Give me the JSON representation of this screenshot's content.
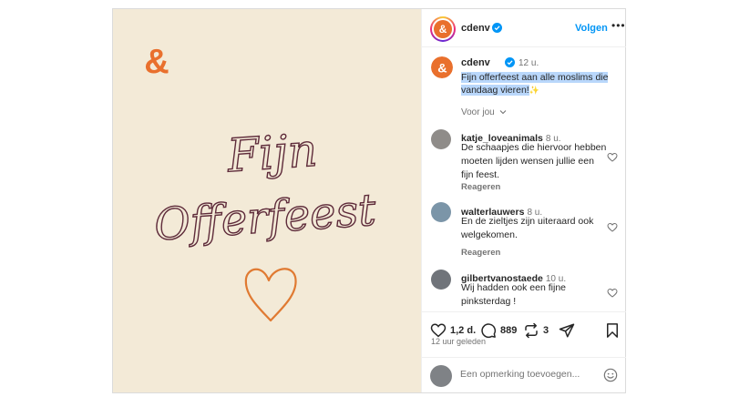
{
  "post": {
    "account": "cdenv",
    "follow_label": "Volgen",
    "more_label": "•••",
    "colors": {
      "brand": "#e9702d",
      "script": "#5e2b3a",
      "background": "#f3ead7",
      "link": "#0095f6"
    },
    "image": {
      "brand_mark": "ampersand-logo",
      "script_line1": "Fijn",
      "script_line2": "Offerfeest",
      "decoration": "heart-outline"
    }
  },
  "caption": {
    "user": "cdenv",
    "time": "12 u.",
    "text": "Fijn offerfeest aan alle moslims die vandaag vieren!",
    "emoji": "✨",
    "for_you": "Voor jou"
  },
  "comments": [
    {
      "user": "katje_loveanimals",
      "time": "8 u.",
      "text": "De schaapjes die hiervoor hebben moeten lijden wensen jullie een fijn feest.",
      "reply": "Reageren"
    },
    {
      "user": "walterlauwers",
      "time": "8 u.",
      "text": "En de zieltjes zijn uiteraard ook welgekomen.",
      "reply": "Reageren"
    },
    {
      "user": "gilbertvanostaede",
      "time": "10 u.",
      "text": "Wij hadden ook een fijne pinksterdag !"
    }
  ],
  "actions": {
    "likes": "1,2 d.",
    "comments": "889",
    "reposts": "3",
    "posted": "12 uur geleden"
  },
  "composer": {
    "placeholder": "Een opmerking toevoegen..."
  }
}
